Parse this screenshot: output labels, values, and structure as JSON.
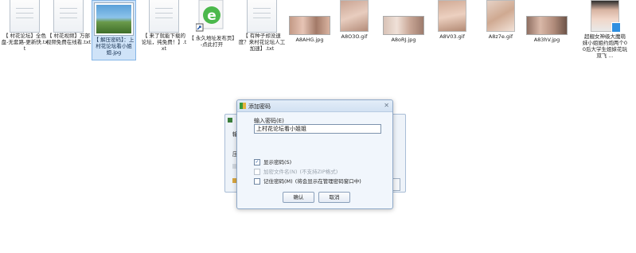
{
  "files": [
    {
      "name": "【 村花论坛】全色盘-无套路-更新快.txt",
      "type": "txt"
    },
    {
      "name": "【 村花视频】万部视频免费在线看.txt",
      "type": "txt"
    },
    {
      "name": "【 解压密码】：上村花论坛看小姐姐.jpg",
      "type": "image-selected"
    },
    {
      "name": "【 来了就能下载的论坛，纯免费！】.txt",
      "type": "txt"
    },
    {
      "name": "【 永久地址发布页】-点此打开",
      "type": "ie-shortcut"
    },
    {
      "name": "【 有种子却没速度？来村花论坛人工加速】.txt",
      "type": "txt"
    },
    {
      "name": "A8AHG.jpg",
      "type": "photo"
    },
    {
      "name": "A8O3O.gif",
      "type": "photo-tall"
    },
    {
      "name": "A8oRJ.jpg",
      "type": "photo"
    },
    {
      "name": "A8V03.gif",
      "type": "photo-tall"
    },
    {
      "name": "A8z7e.gif",
      "type": "photo-tall"
    },
    {
      "name": "A83hV.jpg",
      "type": "photo"
    },
    {
      "name": "超靓女神级大魔萌妹小姐姐约炮两个00后大学生姐妹花玩双飞 ...",
      "type": "photo-tall-video"
    }
  ],
  "bg_dialog": {
    "label1": "输",
    "label2": "压"
  },
  "dialog": {
    "title": "添加密码",
    "close_glyph": "✕",
    "password_label": "输入密码(E)",
    "password_value": "上村花论坛看小姐姐",
    "options": [
      {
        "label": "显示密码(S)",
        "checked": true,
        "enabled": true,
        "hint": ""
      },
      {
        "label": "加密文件名(N)",
        "checked": false,
        "enabled": false,
        "hint": "(不支持ZIP格式)"
      },
      {
        "label": "记住密码(M)",
        "checked": false,
        "enabled": true,
        "hint": "(将会显示在管理密码窗口中)"
      }
    ],
    "ok_label": "确认",
    "cancel_label": "取消"
  },
  "colors": {
    "accent": "#2a5fa8",
    "dialog_bg": "#f1f6fc",
    "selected_bg": "#cfe3f8"
  }
}
